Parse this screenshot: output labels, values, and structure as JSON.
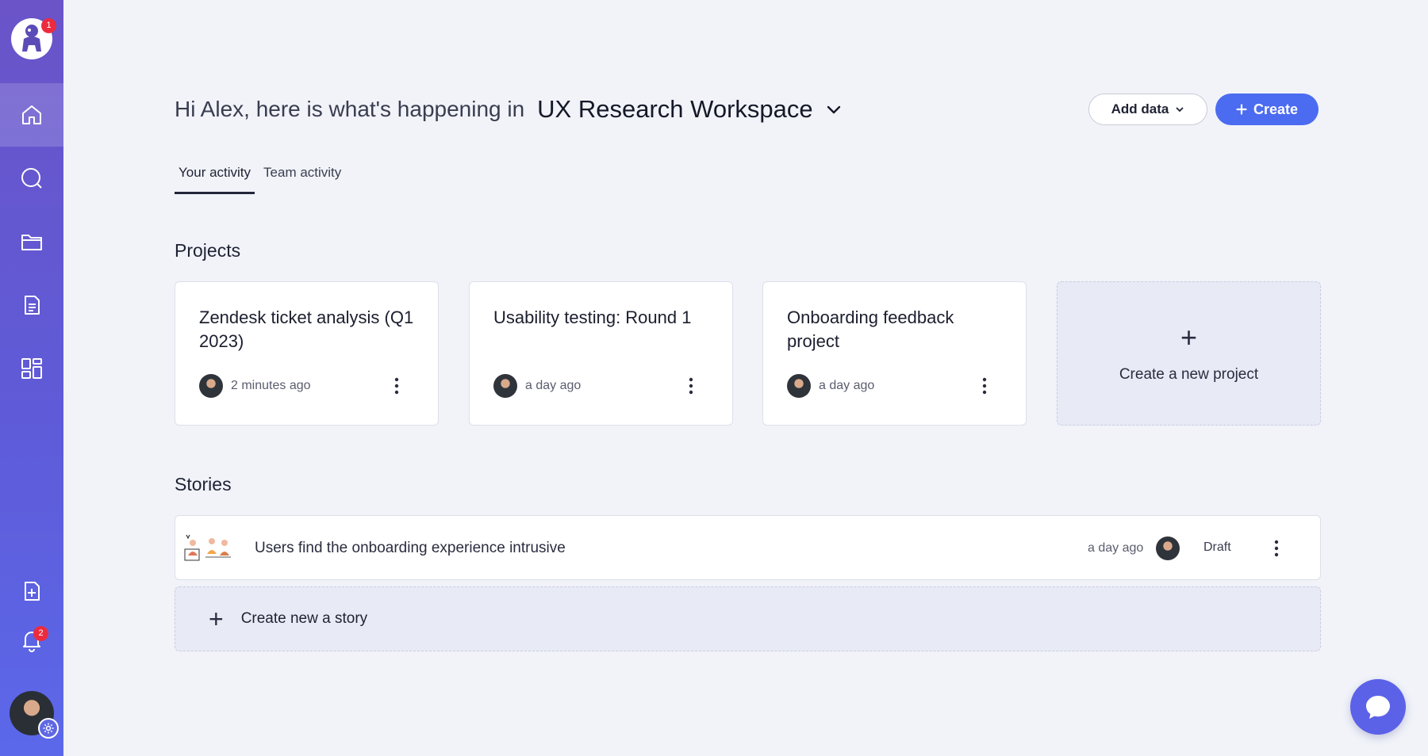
{
  "sidebar": {
    "logo_badge": "1",
    "notifications_badge": "2",
    "items": [
      {
        "name": "home",
        "icon": "home-icon"
      },
      {
        "name": "search",
        "icon": "search-icon"
      },
      {
        "name": "folders",
        "icon": "folder-icon"
      },
      {
        "name": "docs",
        "icon": "document-icon"
      },
      {
        "name": "templates",
        "icon": "layout-icon"
      }
    ]
  },
  "header": {
    "greeting": "Hi Alex, here is what's happening in",
    "workspace": "UX Research Workspace",
    "add_data_label": "Add data",
    "create_label": "Create"
  },
  "tabs": [
    {
      "label": "Your activity",
      "active": true
    },
    {
      "label": "Team activity",
      "active": false
    }
  ],
  "projects": {
    "title": "Projects",
    "items": [
      {
        "title": "Zendesk ticket analysis (Q1 2023)",
        "time": "2 minutes ago"
      },
      {
        "title": "Usability testing: Round 1",
        "time": "a day ago"
      },
      {
        "title": "Onboarding feedback project",
        "time": "a day ago"
      }
    ],
    "create_label": "Create a new project"
  },
  "stories": {
    "title": "Stories",
    "items": [
      {
        "title": "Users find the onboarding experience intrusive",
        "time": "a day ago",
        "status": "Draft"
      }
    ],
    "create_label": "Create new a story"
  },
  "colors": {
    "accent": "#4b6bf0",
    "sidebar_top": "#6a54c8",
    "sidebar_bottom": "#5b68ea",
    "badge": "#ec2b3f"
  }
}
